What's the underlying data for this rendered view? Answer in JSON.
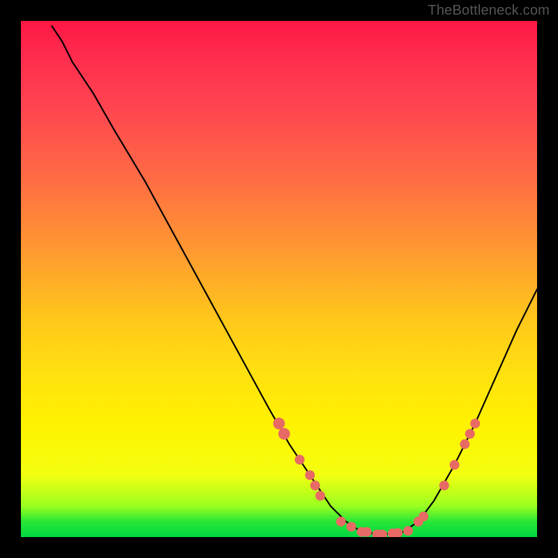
{
  "watermark": "TheBottleneck.com",
  "chart_data": {
    "type": "line",
    "title": "",
    "xlabel": "",
    "ylabel": "",
    "xlim": [
      0,
      100
    ],
    "ylim": [
      0,
      100
    ],
    "grid": false,
    "legend": false,
    "description": "V-shaped bottleneck curve plotted over a red→yellow→green gradient background. The curve starts near the top-left, falls steeply to a minimum around x≈70, then rises toward the right edge. Salmon-colored marker dots cluster on the descending limb (~x 50–60), along the trough (~x 62–78), and on the ascending limb (~x 82–88).",
    "curve_points": [
      {
        "x": 6,
        "y": 99
      },
      {
        "x": 8,
        "y": 96
      },
      {
        "x": 10,
        "y": 92
      },
      {
        "x": 14,
        "y": 86
      },
      {
        "x": 18,
        "y": 79
      },
      {
        "x": 24,
        "y": 69
      },
      {
        "x": 30,
        "y": 58
      },
      {
        "x": 36,
        "y": 47
      },
      {
        "x": 42,
        "y": 36
      },
      {
        "x": 48,
        "y": 25
      },
      {
        "x": 52,
        "y": 18
      },
      {
        "x": 56,
        "y": 12
      },
      {
        "x": 60,
        "y": 6
      },
      {
        "x": 63,
        "y": 3
      },
      {
        "x": 66,
        "y": 1
      },
      {
        "x": 70,
        "y": 0.5
      },
      {
        "x": 74,
        "y": 1
      },
      {
        "x": 77,
        "y": 3
      },
      {
        "x": 80,
        "y": 7
      },
      {
        "x": 84,
        "y": 14
      },
      {
        "x": 88,
        "y": 22
      },
      {
        "x": 92,
        "y": 31
      },
      {
        "x": 96,
        "y": 40
      },
      {
        "x": 100,
        "y": 48
      }
    ],
    "markers": [
      {
        "x": 50,
        "y": 22,
        "r": 1.2
      },
      {
        "x": 51,
        "y": 20,
        "r": 1.2
      },
      {
        "x": 54,
        "y": 15,
        "r": 1.0
      },
      {
        "x": 56,
        "y": 12,
        "r": 1.0
      },
      {
        "x": 57,
        "y": 10,
        "r": 1.0
      },
      {
        "x": 58,
        "y": 8,
        "r": 1.0
      },
      {
        "x": 62,
        "y": 3,
        "r": 1.0
      },
      {
        "x": 64,
        "y": 2,
        "r": 1.0
      },
      {
        "x": 66,
        "y": 1,
        "r": 1.0
      },
      {
        "x": 67,
        "y": 1,
        "r": 1.0
      },
      {
        "x": 69,
        "y": 0.5,
        "r": 1.0
      },
      {
        "x": 70,
        "y": 0.5,
        "r": 1.0
      },
      {
        "x": 72,
        "y": 0.7,
        "r": 1.0
      },
      {
        "x": 73,
        "y": 0.8,
        "r": 1.0
      },
      {
        "x": 75,
        "y": 1.2,
        "r": 1.0
      },
      {
        "x": 77,
        "y": 3,
        "r": 1.0
      },
      {
        "x": 78,
        "y": 4,
        "r": 1.0
      },
      {
        "x": 82,
        "y": 10,
        "r": 1.0
      },
      {
        "x": 84,
        "y": 14,
        "r": 1.0
      },
      {
        "x": 86,
        "y": 18,
        "r": 1.0
      },
      {
        "x": 87,
        "y": 20,
        "r": 1.0
      },
      {
        "x": 88,
        "y": 22,
        "r": 1.0
      }
    ]
  }
}
